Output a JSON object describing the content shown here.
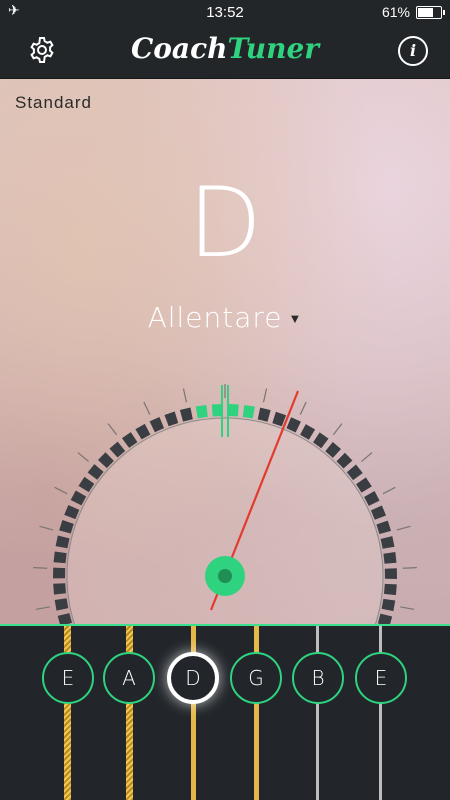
{
  "status": {
    "time": "13:52",
    "battery": "61%",
    "battery_level": 0.61
  },
  "header": {
    "logo_coach": "Coach",
    "logo_tuner": "Tuner",
    "settings_icon": "gear-icon",
    "info_icon": "info-icon",
    "info_glyph": "i"
  },
  "tuner": {
    "tuning_name": "Standard",
    "note": "D",
    "direction": "Allentare",
    "direction_arrow": "▼"
  },
  "strings": [
    {
      "label": "E",
      "active": false
    },
    {
      "label": "A",
      "active": false
    },
    {
      "label": "D",
      "active": true
    },
    {
      "label": "G",
      "active": false
    },
    {
      "label": "B",
      "active": false
    },
    {
      "label": "E",
      "active": false
    }
  ],
  "colors": {
    "accent": "#2fd27f",
    "needle": "#e23b2e",
    "background": "#22262a"
  }
}
